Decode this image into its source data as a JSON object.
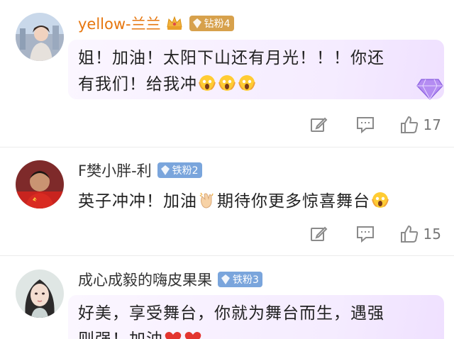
{
  "comments": [
    {
      "username": "yellow-兰兰",
      "badge": "钻粉4",
      "text_line1": "姐！加油！太阳下山还有月光！！！你还",
      "text_line2": "有我们！给我冲",
      "like_count": "17"
    },
    {
      "username": "F樊小胖-利",
      "badge": "铁粉2",
      "text_before": "英子冲冲！加油",
      "text_after": "期待你更多惊喜舞台",
      "like_count": "15"
    },
    {
      "username": "成心成毅的嗨皮果果",
      "badge": "铁粉3",
      "text_line1": "好美，享受舞台，你就为舞台而生，遇强",
      "text_line2": "则强！加油"
    }
  ],
  "colors": {
    "vip_username": "#e6760e",
    "gold_badge": "#d7a14c",
    "iron_badge": "#7aa5dc",
    "icon_gray": "#8a8a8a"
  },
  "icons": [
    "edit-icon",
    "comment-icon",
    "thumbs-up-icon",
    "crown-icon",
    "diamond-icon",
    "scream-emoji",
    "clap-emoji",
    "heart-emoji"
  ]
}
